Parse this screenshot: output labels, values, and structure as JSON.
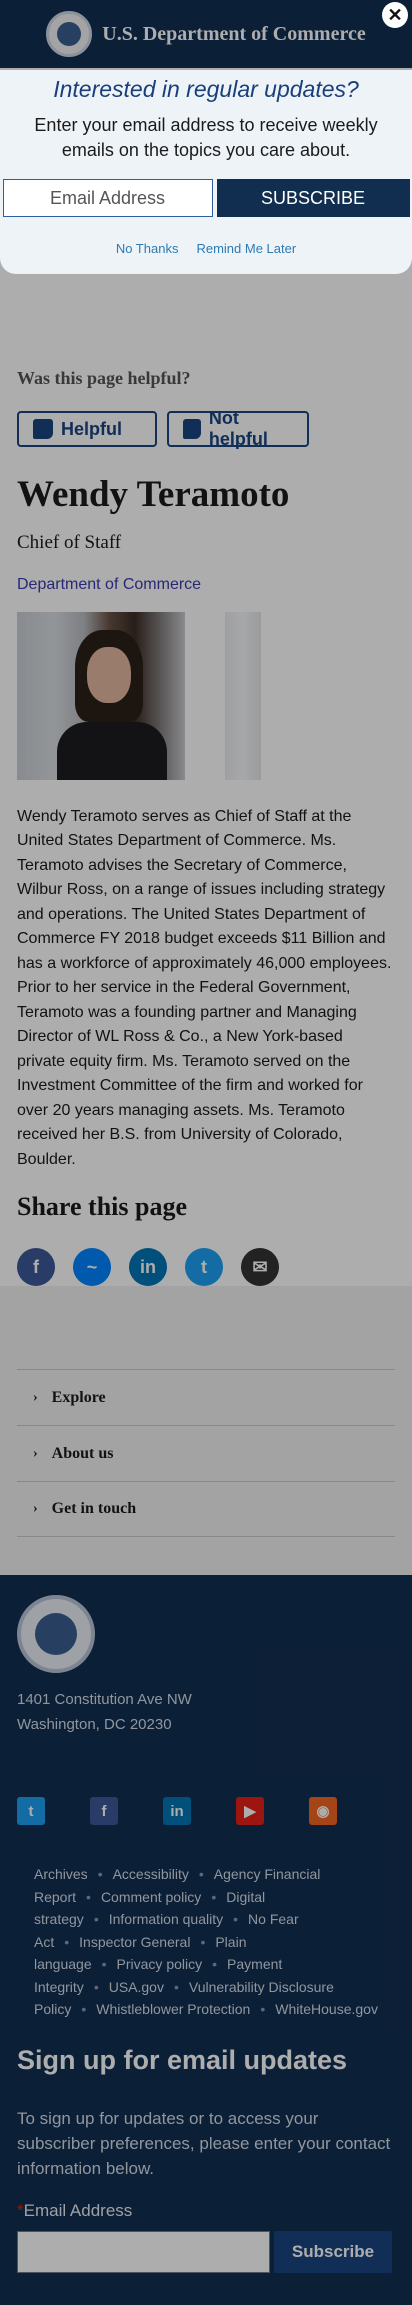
{
  "header": {
    "title": "U.S. Department of Commerce"
  },
  "modal": {
    "title": "Interested in regular updates?",
    "description": "Enter your email address to receive weekly emails on the topics you care about.",
    "email_placeholder": "Email Address",
    "subscribe_label": "SUBSCRIBE",
    "no_thanks_label": "No Thanks",
    "remind_label": "Remind Me Later",
    "close_glyph": "✕"
  },
  "feedback": {
    "question": "Was this page helpful?",
    "helpful_label": "Helpful",
    "not_helpful_label": "Not helpful"
  },
  "profile": {
    "name": "Wendy Teramoto",
    "title": "Chief of Staff",
    "department": "Department of Commerce",
    "bio": "Wendy Teramoto serves as Chief of Staff at the United States Department of Commerce.  Ms. Teramoto advises the Secretary of Commerce, Wilbur Ross, on a range of issues including strategy and operations.  The United States Department of Commerce FY 2018 budget exceeds $11 Billion and has a workforce of approximately 46,000 employees. Prior to her service in the Federal Government, Teramoto was a founding partner and Managing Director of WL Ross & Co., a New York-based private equity firm. Ms. Teramoto served on the Investment Committee of the firm and worked for over 20 years managing assets.  Ms. Teramoto received her B.S. from University of Colorado, Boulder."
  },
  "share": {
    "title": "Share this page",
    "items": [
      {
        "name": "facebook",
        "glyph": "f",
        "color": "#3b5998"
      },
      {
        "name": "messenger",
        "glyph": "~",
        "color": "#0084ff"
      },
      {
        "name": "linkedin",
        "glyph": "in",
        "color": "#0077b5"
      },
      {
        "name": "twitter",
        "glyph": "t",
        "color": "#1da1f2"
      },
      {
        "name": "email",
        "glyph": "✉",
        "color": "#333333"
      }
    ]
  },
  "accordion": {
    "items": [
      {
        "label": "Explore"
      },
      {
        "label": "About us"
      },
      {
        "label": "Get in touch"
      }
    ]
  },
  "footer": {
    "address_line1": "1401 Constitution Ave NW",
    "address_line2": "Washington, DC 20230",
    "social": [
      {
        "name": "twitter",
        "glyph": "t",
        "color": "#1da1f2"
      },
      {
        "name": "facebook",
        "glyph": "f",
        "color": "#3b5998"
      },
      {
        "name": "linkedin",
        "glyph": "in",
        "color": "#0077b5"
      },
      {
        "name": "youtube",
        "glyph": "▶",
        "color": "#e62117"
      },
      {
        "name": "rss",
        "glyph": "◉",
        "color": "#f26522"
      }
    ],
    "links": [
      "Archives",
      "Accessibility",
      "Agency Financial Report",
      "Comment policy",
      "Digital strategy",
      "Information quality",
      "No Fear Act",
      "Inspector General",
      "Plain language",
      "Privacy policy",
      "Payment Integrity",
      "USA.gov",
      "Vulnerability Disclosure Policy",
      "Whistleblower Protection",
      "WhiteHouse.gov"
    ],
    "link_separator": "•",
    "signup_title": "Sign up for email updates",
    "signup_desc": "To sign up for updates or to access your subscriber preferences, please enter your contact information below.",
    "required_mark": "*",
    "email_label": "Email Address",
    "subscribe_label": "Subscribe"
  },
  "colors": {
    "navy": "#112e51",
    "accent": "#1a4480"
  }
}
